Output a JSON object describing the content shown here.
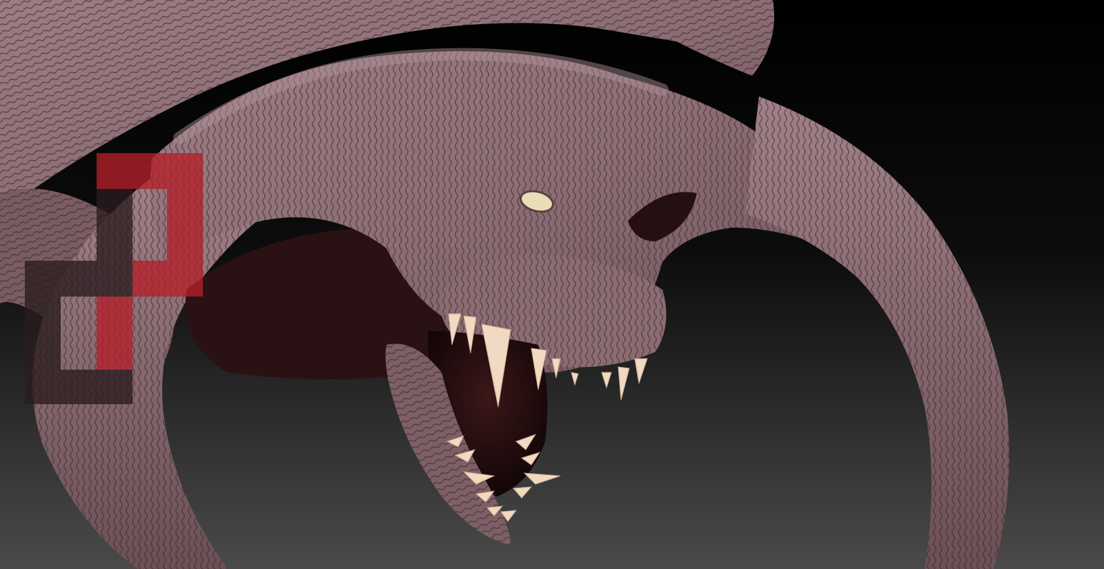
{
  "viewport": {
    "colors": {
      "background_top": "#000000",
      "background_bottom": "#4a4a4a",
      "skin_light": "#a8878e",
      "skin_mid": "#7e6268",
      "skin_dark": "#3a2428",
      "mouth_interior": "#1c0b0d",
      "teeth": "#f2d9c2",
      "eye": "#e9ddb8",
      "logo_red": "#b3202a",
      "logo_dark": "#2a1c1e"
    },
    "elements": [
      "creature-sculpt",
      "open-jaw",
      "fang-teeth",
      "left-horn",
      "right-horn",
      "pixel-logo-watermark"
    ]
  }
}
